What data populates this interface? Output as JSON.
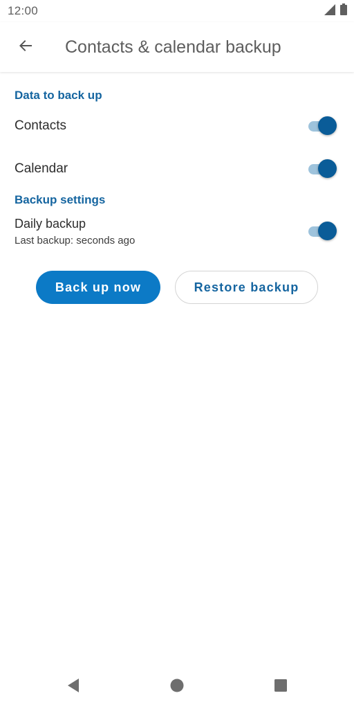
{
  "status_bar": {
    "time": "12:00",
    "icons": [
      "signal-icon",
      "battery-icon"
    ]
  },
  "app_bar": {
    "back_icon": "arrow-back-icon",
    "title": "Contacts & calendar backup"
  },
  "sections": {
    "data_header": "Data to back up",
    "settings_header": "Backup settings"
  },
  "rows": {
    "contacts": {
      "label": "Contacts",
      "enabled": true
    },
    "calendar": {
      "label": "Calendar",
      "enabled": true
    },
    "daily": {
      "label": "Daily backup",
      "subtitle": "Last backup: seconds ago",
      "enabled": true
    }
  },
  "buttons": {
    "backup_now": "Back up now",
    "restore": "Restore backup"
  },
  "nav_bar": {
    "icons": [
      "back-triangle-icon",
      "home-circle-icon",
      "recents-square-icon"
    ]
  },
  "colors": {
    "accent": "#1565a0",
    "primary_button": "#0c7ac6",
    "switch_thumb": "#0a5c98",
    "switch_track": "#9ec3dc"
  }
}
